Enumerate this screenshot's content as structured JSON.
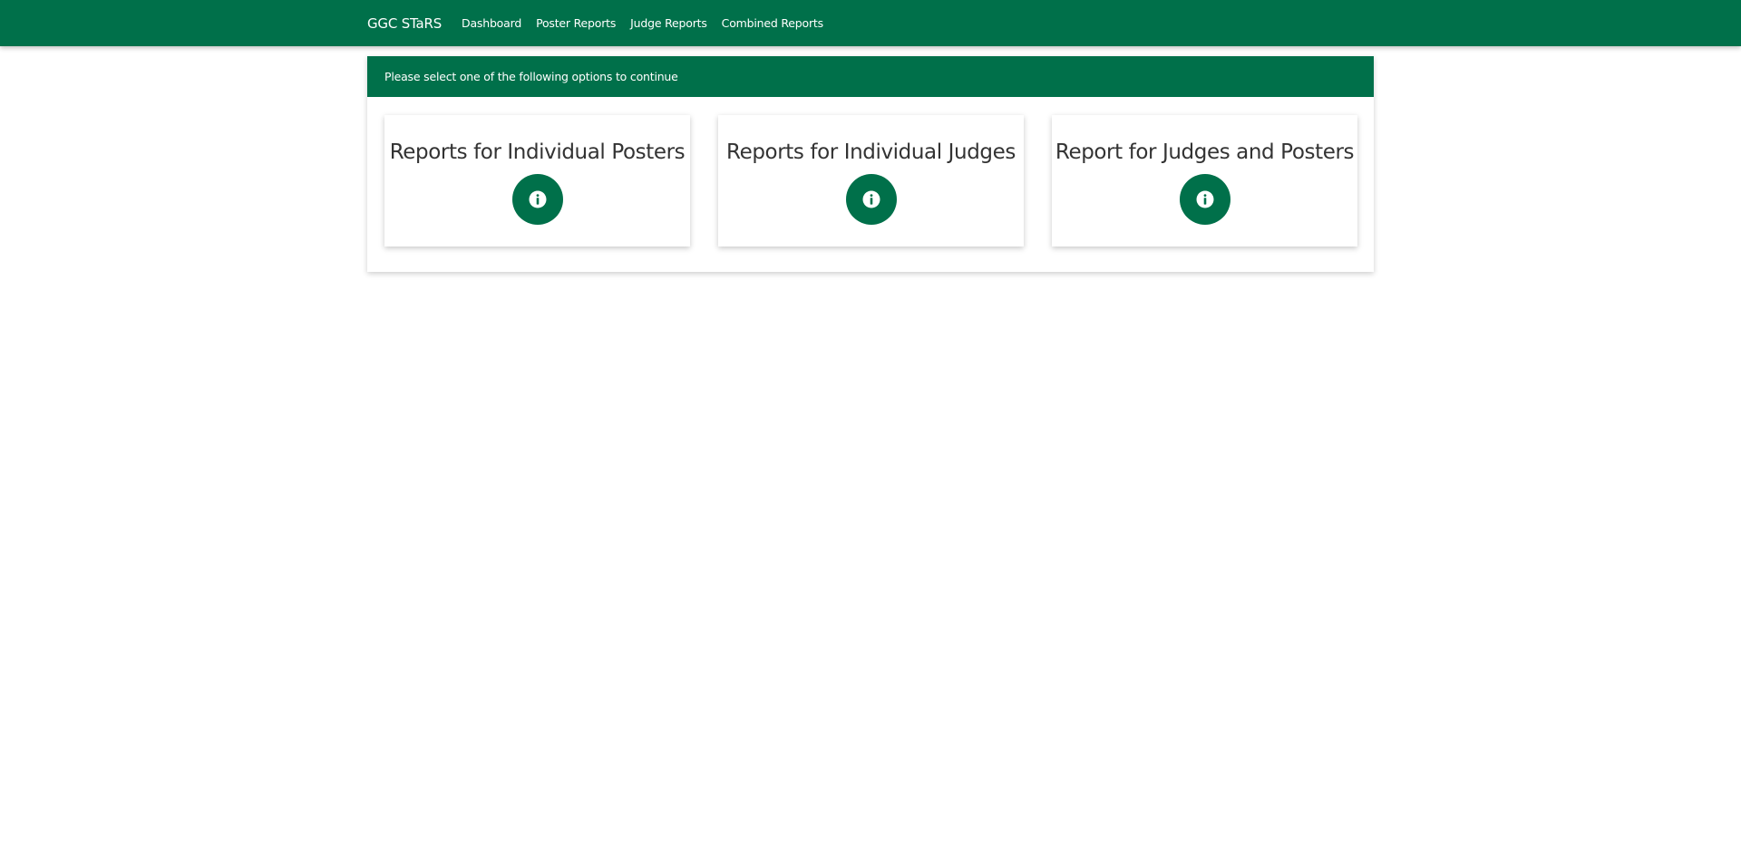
{
  "navbar": {
    "brand": "GGC STaRS",
    "links": [
      "Dashboard",
      "Poster Reports",
      "Judge Reports",
      "Combined Reports"
    ]
  },
  "panel": {
    "header": "Please select one of the following options to continue"
  },
  "cards": [
    {
      "title": "Reports for Individual Posters",
      "icon": "info-circle-icon"
    },
    {
      "title": "Reports for Individual Judges",
      "icon": "info-circle-icon"
    },
    {
      "title": "Report for Judges and Posters",
      "icon": "info-circle-icon"
    }
  ],
  "colors": {
    "primary": "#00704a",
    "text": "#333333",
    "background": "#ffffff"
  }
}
